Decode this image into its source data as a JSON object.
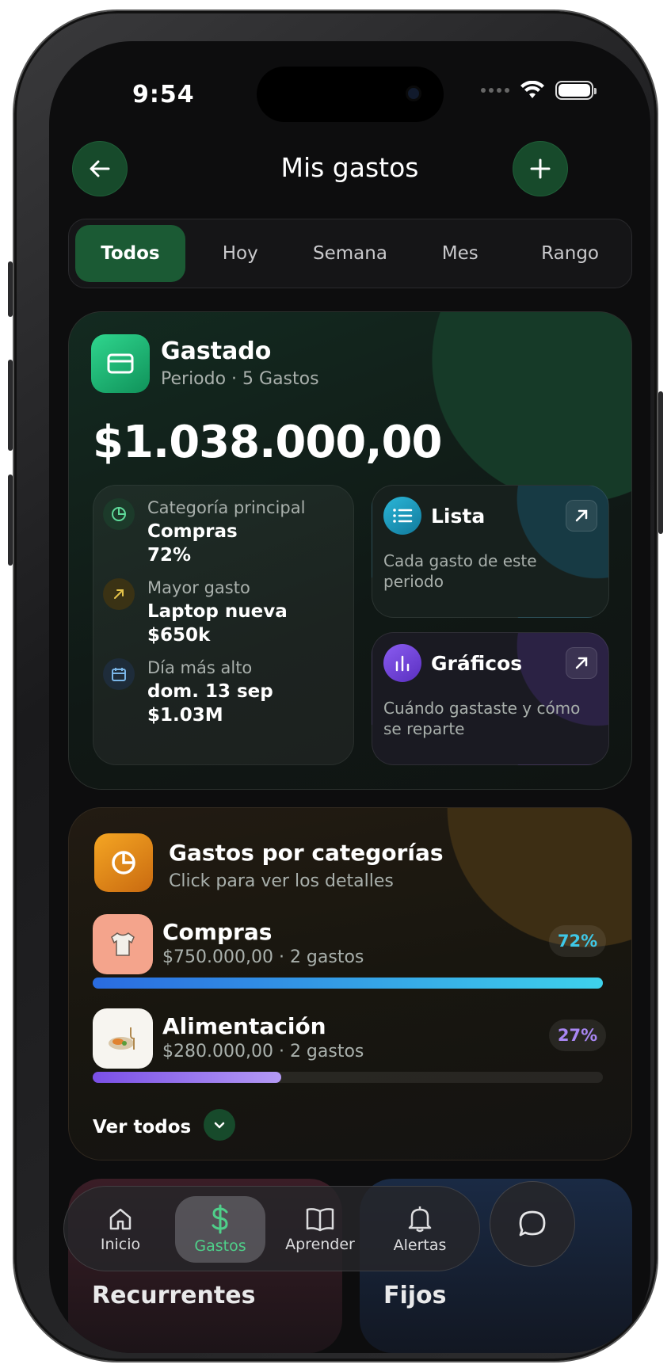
{
  "status": {
    "time": "9:54"
  },
  "header": {
    "title": "Mis gastos"
  },
  "tabs": [
    {
      "label": "Todos",
      "active": true
    },
    {
      "label": "Hoy"
    },
    {
      "label": "Semana"
    },
    {
      "label": "Mes"
    },
    {
      "label": "Rango"
    }
  ],
  "summary": {
    "title": "Gastado",
    "subtitle": "Periodo · 5 Gastos",
    "amount": "$1.038.000,00",
    "stats": [
      {
        "label": "Categoría principal",
        "value": "Compras",
        "extra": "72%"
      },
      {
        "label": "Mayor gasto",
        "value": "Laptop nueva",
        "extra": "$650k"
      },
      {
        "label": "Día más alto",
        "value": "dom. 13 sep",
        "extra": "$1.03M"
      }
    ],
    "list_card": {
      "title": "Lista",
      "desc": "Cada gasto de este periodo"
    },
    "charts_card": {
      "title": "Gráficos",
      "desc": "Cuándo gastaste y cómo se reparte"
    }
  },
  "categories": {
    "title": "Gastos por categorías",
    "subtitle": "Click para ver los detalles",
    "items": [
      {
        "name": "Compras",
        "detail": "$750.000,00 · 2 gastos",
        "pct_label": "72%",
        "pct": 1.0,
        "color": "#3ec8e8"
      },
      {
        "name": "Alimentación",
        "detail": "$280.000,00 · 2 gastos",
        "pct_label": "27%",
        "pct": 0.37,
        "color": "#a886f2"
      }
    ],
    "see_all": "Ver todos"
  },
  "under": {
    "left": "Recurrentes",
    "right": "Fijos"
  },
  "nav": [
    {
      "label": "Inicio",
      "icon": "home-icon"
    },
    {
      "label": "Gastos",
      "icon": "dollar-icon",
      "active": true
    },
    {
      "label": "Aprender",
      "icon": "book-icon"
    },
    {
      "label": "Alertas",
      "icon": "bell-icon"
    }
  ],
  "colors": {
    "accent_green": "#1b5a34",
    "bg": "#0d0d0e"
  }
}
